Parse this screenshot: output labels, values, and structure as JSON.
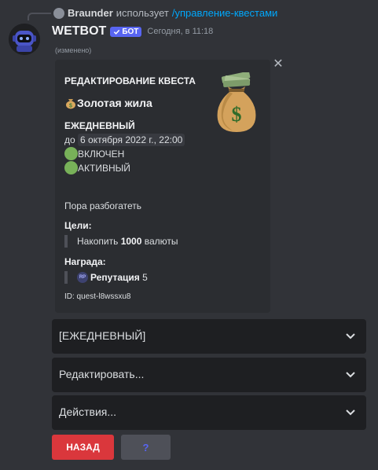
{
  "reply": {
    "user": "Braunder",
    "verb": "использует",
    "command": "/управление-квестами"
  },
  "message": {
    "author": "WETBOT",
    "bot_badge": "БОТ",
    "timestamp": "Сегодня, в 11:18",
    "edited": "(изменено)"
  },
  "embed": {
    "title": "РЕДАКТИРОВАНИЕ КВЕСТА",
    "quest_icon": "money-bag-emoji",
    "quest_name": "Золотая жила",
    "frequency": "ЕЖЕДНЕВНЫЙ",
    "until_prefix": "до",
    "until_date": "6 октября 2022 г., 22:00",
    "status_enabled": "ВКЛЮЧЕН",
    "status_active": "АКТИВНЫЙ",
    "description": "Пора разбогатеть",
    "goals_label": "Цели:",
    "goal_prefix": "Накопить",
    "goal_amount": "1000",
    "goal_suffix": "валюты",
    "reward_label": "Награда:",
    "reward_icon_text": "RP",
    "reward_name": "Репутация",
    "reward_amount": "5",
    "quest_id": "ID: quest-l8wssxu8"
  },
  "selects": {
    "frequency": "[ЕЖЕДНЕВНЫЙ]",
    "edit": "Редактировать...",
    "actions": "Действия..."
  },
  "buttons": {
    "back": "НАЗАД",
    "help": "?"
  },
  "colors": {
    "background": "#313338",
    "embed": "#2b2d31",
    "select": "#1e1f22",
    "accent": "#5865f2",
    "danger": "#da373c",
    "link": "#00a8fc",
    "status_green": "#78b159"
  }
}
